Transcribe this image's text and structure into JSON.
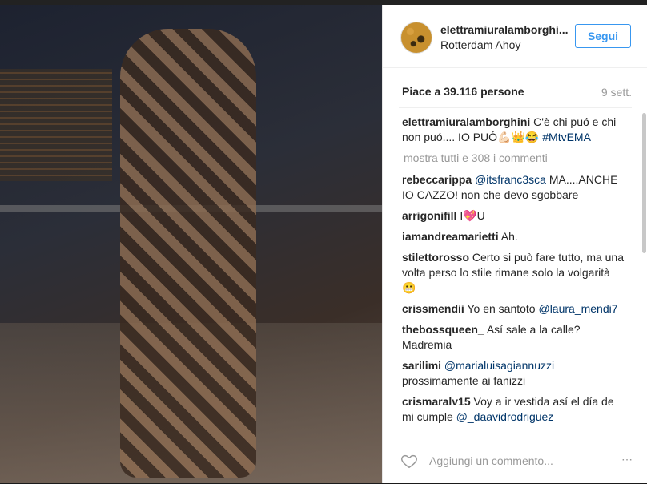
{
  "post": {
    "username": "elettramiuralamborghi...",
    "location": "Rotterdam Ahoy",
    "follow_label": "Segui",
    "likes": "Piace a 39.116 persone",
    "time": "9 sett."
  },
  "caption": {
    "user": "elettramiuralamborghini",
    "text": "C'è chi puó e chi non puó.... IO PUÓ💪🏻👑😂",
    "hashtag": "#MtvEMA"
  },
  "more_comments": "mostra tutti e 308 i commenti",
  "comments": [
    {
      "user": "rebeccarippa",
      "mention": "@itsfranc3sca",
      "text": "MA....ANCHE IO CAZZO! non che devo sgobbare"
    },
    {
      "user": "arrigonifill",
      "mention": "",
      "text": "I💖U"
    },
    {
      "user": "iamandreamarietti",
      "mention": "",
      "text": "Ah."
    },
    {
      "user": "stilettorosso",
      "mention": "",
      "text": "Certo si può fare tutto, ma una volta perso lo stile rimane solo la volgarità 😬"
    },
    {
      "user": "crissmendii",
      "mention": "",
      "text": "Yo en santoto",
      "mention_after": "@laura_mendi7"
    },
    {
      "user": "thebossqueen_",
      "mention": "",
      "text": "Así sale a la calle? Madremia"
    },
    {
      "user": "sarilimi",
      "mention": "@marialuisagiannuzzi",
      "text": "prossimamente ai fanizzi"
    },
    {
      "user": "crismaralv15",
      "mention": "",
      "text": "Voy a ir vestida así el día de mi cumple",
      "mention_after": "@_daavidrodriguez"
    }
  ],
  "add_comment_placeholder": "Aggiungi un commento...",
  "more_options": "⋯",
  "icons": {
    "like": "heart-icon",
    "options": "more-options-icon"
  }
}
